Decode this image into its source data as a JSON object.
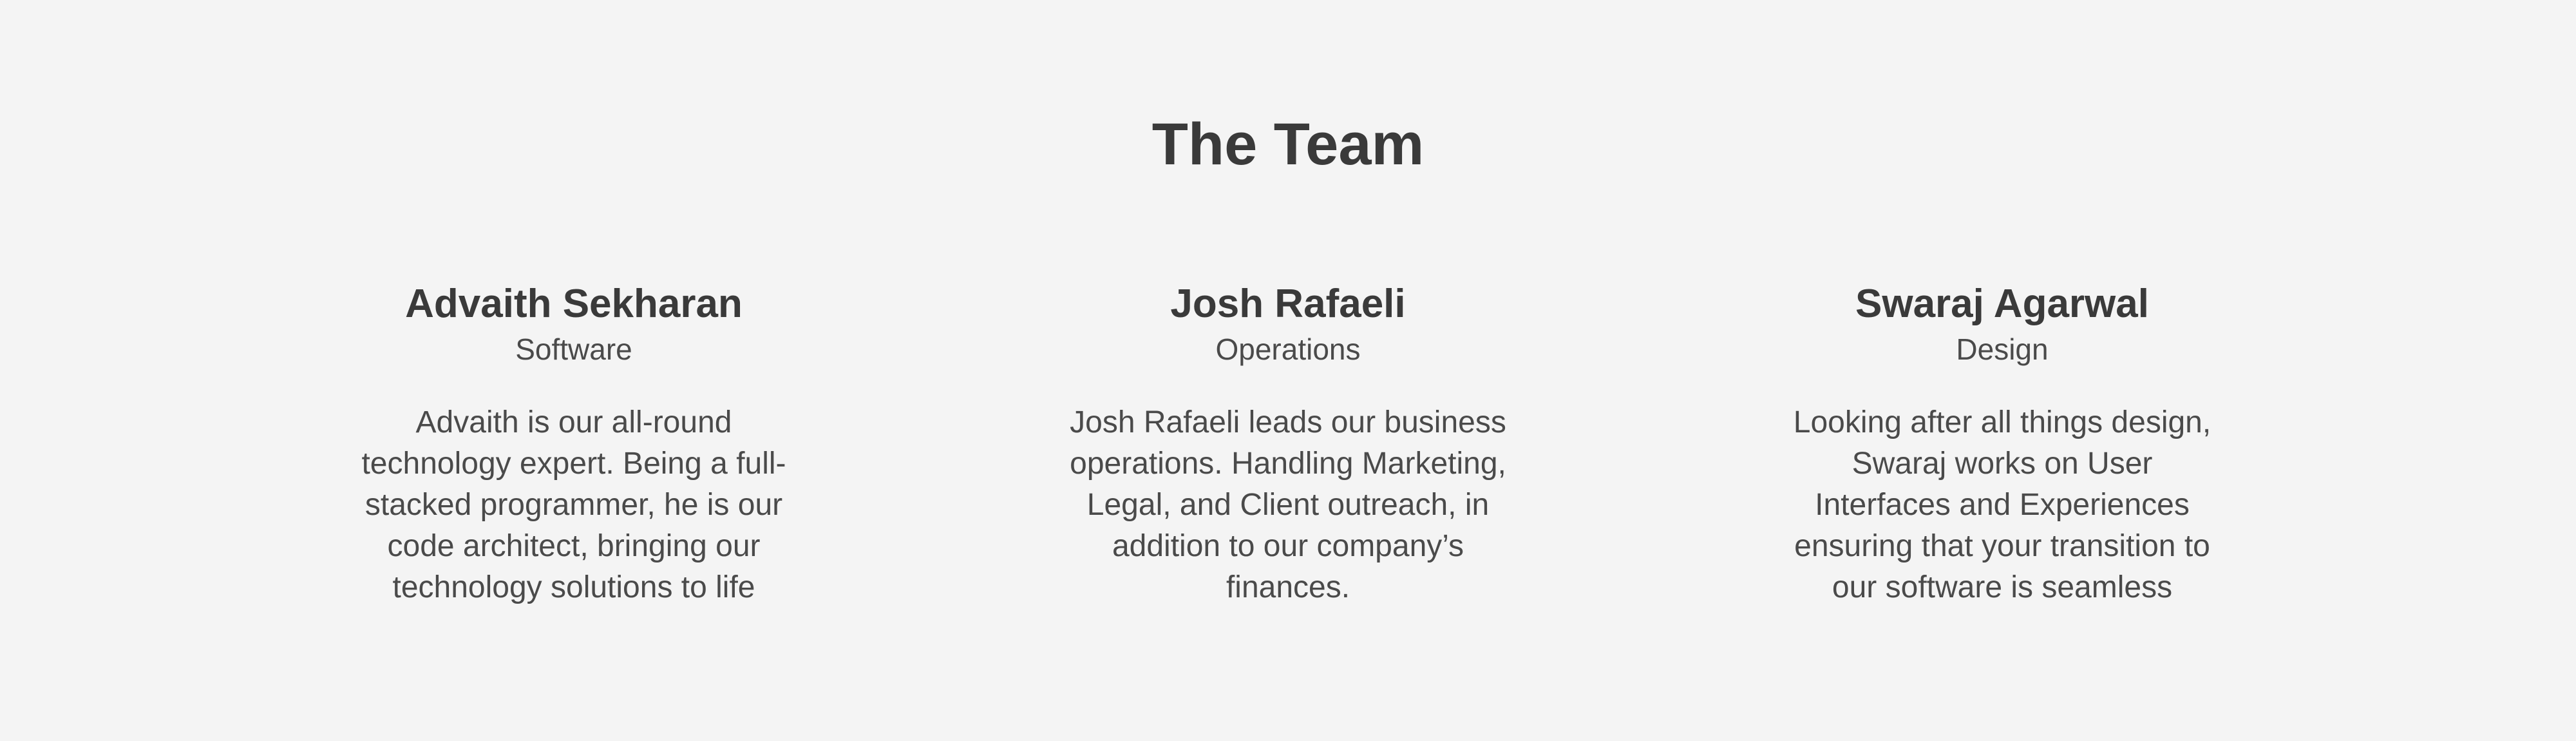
{
  "team_section": {
    "title": "The Team",
    "members": [
      {
        "name": "Advaith Sekharan",
        "role": "Software",
        "bio": "Advaith is our all-round technology expert. Being a full-stacked programmer, he is our code architect, bringing our technology solutions to life"
      },
      {
        "name": "Josh Rafaeli",
        "role": "Operations",
        "bio": "Josh Rafaeli leads our business operations. Handling Marketing, Legal, and Client outreach, in addition to our company’s finances."
      },
      {
        "name": "Swaraj Agarwal",
        "role": "Design",
        "bio": "Looking after all things design, Swaraj works on User Interfaces and Experiences ensuring that your transition to our software is seamless"
      }
    ]
  },
  "colors": {
    "background": "#f4f4f4",
    "heading": "#3a3a3a",
    "body_text": "#4a4a4a"
  }
}
